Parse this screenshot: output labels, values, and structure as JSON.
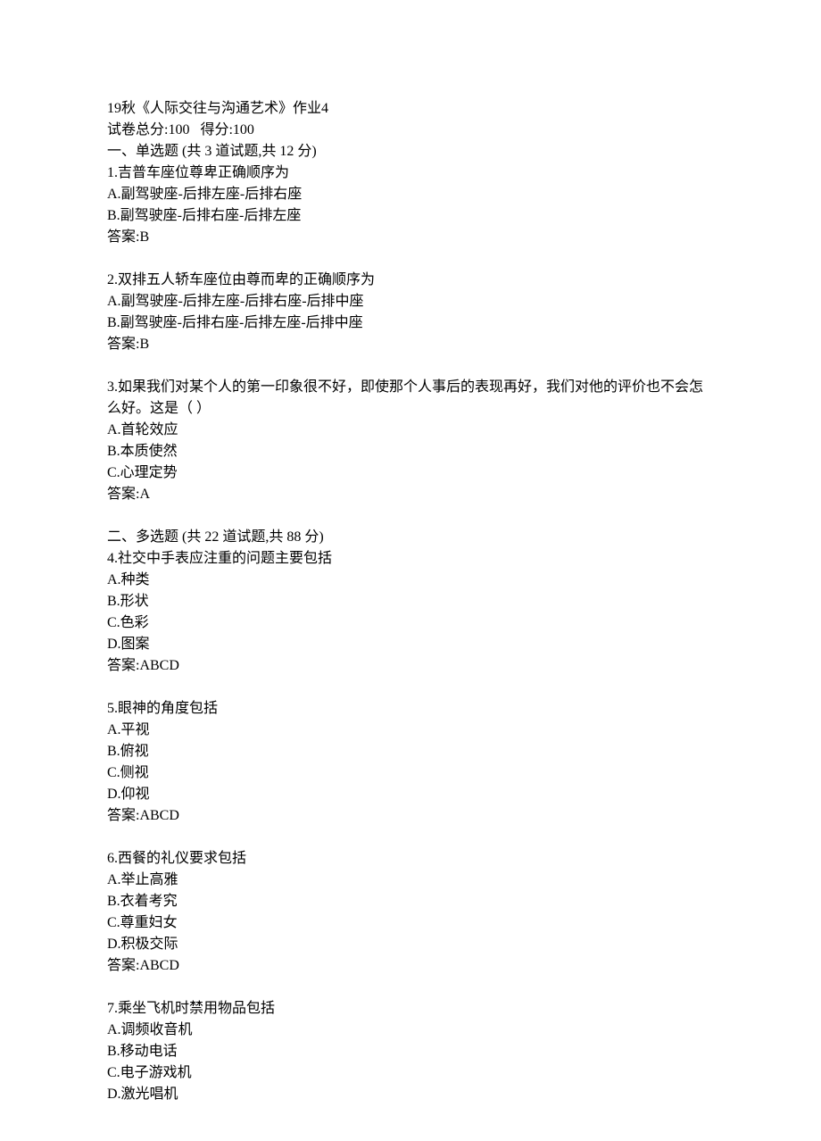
{
  "header": {
    "title": "19秋《人际交往与沟通艺术》作业4",
    "score_line": "试卷总分:100   得分:100"
  },
  "section1": {
    "heading": "一、单选题 (共 3 道试题,共 12 分)",
    "q1": {
      "text": "1.吉普车座位尊卑正确顺序为",
      "a": "A.副驾驶座-后排左座-后排右座",
      "b": "B.副驾驶座-后排右座-后排左座",
      "answer": "答案:B"
    },
    "q2": {
      "text": "2.双排五人轿车座位由尊而卑的正确顺序为",
      "a": "A.副驾驶座-后排左座-后排右座-后排中座",
      "b": "B.副驾驶座-后排右座-后排左座-后排中座",
      "answer": "答案:B"
    },
    "q3": {
      "text": "3.如果我们对某个人的第一印象很不好，即使那个人事后的表现再好，我们对他的评价也不会怎么好。这是（ ）",
      "a": "A.首轮效应",
      "b": "B.本质使然",
      "c": "C.心理定势",
      "answer": "答案:A"
    }
  },
  "section2": {
    "heading": "二、多选题 (共 22 道试题,共 88 分)",
    "q4": {
      "text": "4.社交中手表应注重的问题主要包括",
      "a": "A.种类",
      "b": "B.形状",
      "c": "C.色彩",
      "d": "D.图案",
      "answer": "答案:ABCD"
    },
    "q5": {
      "text": "5.眼神的角度包括",
      "a": "A.平视",
      "b": "B.俯视",
      "c": "C.侧视",
      "d": "D.仰视",
      "answer": "答案:ABCD"
    },
    "q6": {
      "text": "6.西餐的礼仪要求包括",
      "a": "A.举止高雅",
      "b": "B.衣着考究",
      "c": "C.尊重妇女",
      "d": "D.积极交际",
      "answer": "答案:ABCD"
    },
    "q7": {
      "text": "7.乘坐飞机时禁用物品包括",
      "a": "A.调频收音机",
      "b": "B.移动电话",
      "c": "C.电子游戏机",
      "d": "D.激光唱机"
    }
  }
}
